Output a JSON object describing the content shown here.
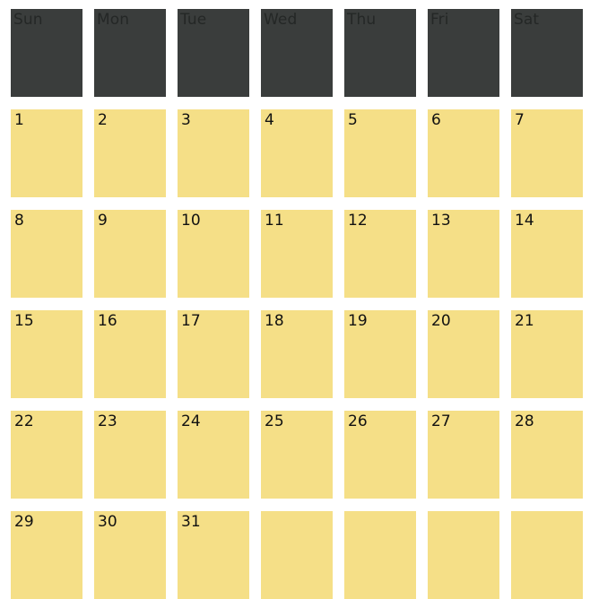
{
  "calendar": {
    "colors": {
      "page_background": "#ffffff",
      "header_cell": "#3a3d3c",
      "header_text": "#242726",
      "day_cell": "#f5df87",
      "day_text": "#111111"
    },
    "weekday_headers": [
      {
        "label": "Sun"
      },
      {
        "label": "Mon"
      },
      {
        "label": "Tue"
      },
      {
        "label": "Wed"
      },
      {
        "label": "Thu"
      },
      {
        "label": "Fri"
      },
      {
        "label": "Sat"
      }
    ],
    "weeks": [
      {
        "days": [
          {
            "number": "1"
          },
          {
            "number": "2"
          },
          {
            "number": "3"
          },
          {
            "number": "4"
          },
          {
            "number": "5"
          },
          {
            "number": "6"
          },
          {
            "number": "7"
          }
        ]
      },
      {
        "days": [
          {
            "number": "8"
          },
          {
            "number": "9"
          },
          {
            "number": "10"
          },
          {
            "number": "11"
          },
          {
            "number": "12"
          },
          {
            "number": "13"
          },
          {
            "number": "14"
          }
        ]
      },
      {
        "days": [
          {
            "number": "15"
          },
          {
            "number": "16"
          },
          {
            "number": "17"
          },
          {
            "number": "18"
          },
          {
            "number": "19"
          },
          {
            "number": "20"
          },
          {
            "number": "21"
          }
        ]
      },
      {
        "days": [
          {
            "number": "22"
          },
          {
            "number": "23"
          },
          {
            "number": "24"
          },
          {
            "number": "25"
          },
          {
            "number": "26"
          },
          {
            "number": "27"
          },
          {
            "number": "28"
          }
        ]
      },
      {
        "days": [
          {
            "number": "29"
          },
          {
            "number": "30"
          },
          {
            "number": "31"
          },
          {
            "number": ""
          },
          {
            "number": ""
          },
          {
            "number": ""
          },
          {
            "number": ""
          }
        ]
      }
    ]
  }
}
